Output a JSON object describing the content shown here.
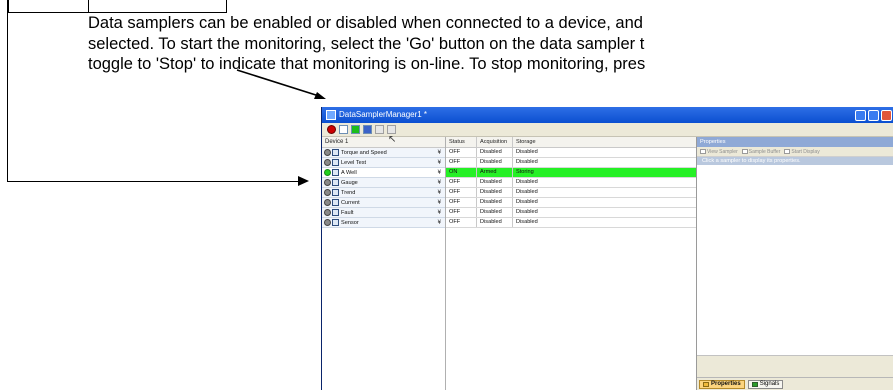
{
  "doc": {
    "lines": [
      "Data samplers can be enabled or disabled when connected to a device, and",
      "selected. To start the monitoring, select the 'Go' button on the data sampler t",
      "toggle to 'Stop' to indicate that monitoring is on-line. To stop monitoring, pres"
    ]
  },
  "window": {
    "title": "DataSamplerManager1 *",
    "controls": [
      "minimize-icon",
      "maximize-icon",
      "close-icon"
    ]
  },
  "toolbar": {
    "buttons": [
      "go-icon",
      "new-sampler-icon",
      "enable-icon",
      "save-icon",
      "print-icon",
      "copy-icon"
    ]
  },
  "devices": {
    "header": "Device 1",
    "items": [
      {
        "name": "Torque and Speed",
        "active": false
      },
      {
        "name": "Level Test",
        "active": false
      },
      {
        "name": "A Well",
        "active": true
      },
      {
        "name": "Gauge",
        "active": false
      },
      {
        "name": "Trend",
        "active": false
      },
      {
        "name": "Current",
        "active": false
      },
      {
        "name": "Fault",
        "active": false
      },
      {
        "name": "Sensor",
        "active": false
      }
    ]
  },
  "grid": {
    "columns": [
      "Status",
      "Acquisition",
      "Storage"
    ],
    "rows": [
      {
        "status": "OFF",
        "acquisition": "Disabled",
        "storage": "Disabled",
        "highlight": false
      },
      {
        "status": "OFF",
        "acquisition": "Disabled",
        "storage": "Disabled",
        "highlight": false
      },
      {
        "status": "ON",
        "acquisition": "Armed",
        "storage": "Storing",
        "highlight": true
      },
      {
        "status": "OFF",
        "acquisition": "Disabled",
        "storage": "Disabled",
        "highlight": false
      },
      {
        "status": "OFF",
        "acquisition": "Disabled",
        "storage": "Disabled",
        "highlight": false
      },
      {
        "status": "OFF",
        "acquisition": "Disabled",
        "storage": "Disabled",
        "highlight": false
      },
      {
        "status": "OFF",
        "acquisition": "Disabled",
        "storage": "Disabled",
        "highlight": false
      },
      {
        "status": "OFF",
        "acquisition": "Disabled",
        "storage": "Disabled",
        "highlight": false
      }
    ]
  },
  "properties": {
    "title": "Properties",
    "toolbar": [
      "View Sampler",
      "Sample Buffer",
      "Start Display"
    ],
    "hint": "Click a sampler to display its properties.",
    "tabs": [
      {
        "label": "Properties",
        "active": true
      },
      {
        "label": "Signals",
        "active": false
      }
    ]
  },
  "cursor_glyph": "↖"
}
